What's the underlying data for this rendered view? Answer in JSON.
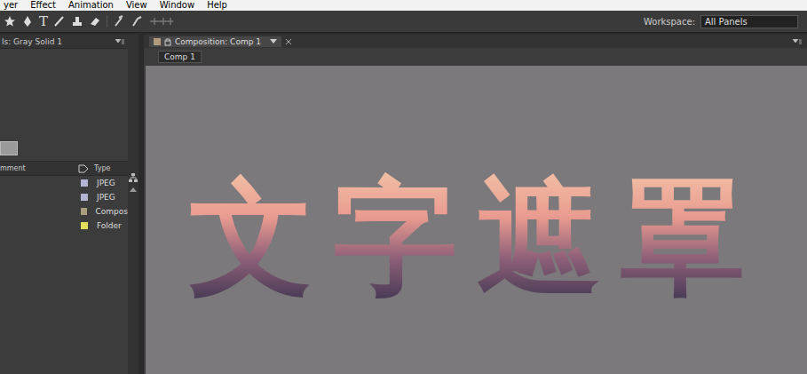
{
  "menu": [
    "yer",
    "Effect",
    "Animation",
    "View",
    "Window",
    "Help"
  ],
  "toolbar": {
    "text_tool": "T"
  },
  "workspace": {
    "label": "Workspace:",
    "value": "All Panels"
  },
  "left_panel": {
    "title": "ls: Gray Solid 1",
    "columns": [
      "mment",
      "Type"
    ],
    "rows": [
      {
        "type": "JPEG",
        "color": "#b4b4d4"
      },
      {
        "type": "JPEG",
        "color": "#b4b4d4"
      },
      {
        "type": "Compos",
        "color": "#a99d7c"
      },
      {
        "type": "Folder",
        "color": "#e3dd5c"
      }
    ]
  },
  "comp_panel": {
    "tab": "Composition: Comp 1",
    "breadcrumb": "Comp 1",
    "canvas_text": "文字遮罩"
  }
}
